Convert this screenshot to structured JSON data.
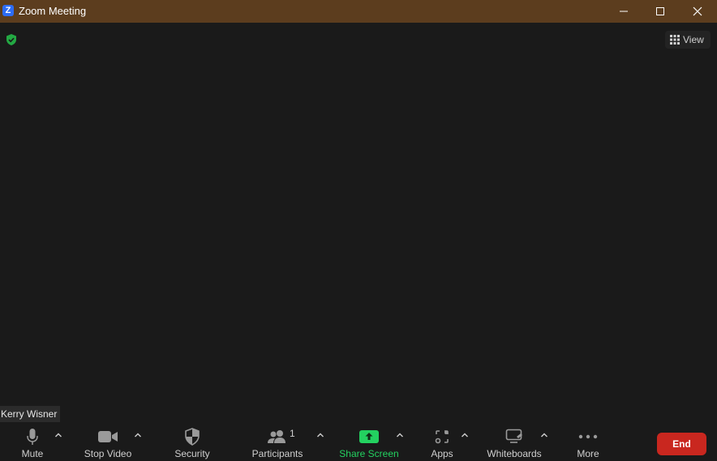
{
  "window": {
    "title": "Zoom Meeting",
    "logo_letter": "Z"
  },
  "colors": {
    "titlebar": "#5c3d1e",
    "background": "#1a1a1a",
    "security_green": "#23a943",
    "share_green": "#23d160",
    "end_red": "#c9271f",
    "logo_blue": "#2d6cf6"
  },
  "top": {
    "view_label": "View"
  },
  "participant_name": "Kerry Wisner",
  "toolbar": {
    "mute_label": "Mute",
    "stop_video_label": "Stop Video",
    "security_label": "Security",
    "participants_label": "Participants",
    "participants_count": "1",
    "share_screen_label": "Share Screen",
    "apps_label": "Apps",
    "whiteboards_label": "Whiteboards",
    "more_label": "More",
    "end_label": "End"
  },
  "icons": {
    "app": "zoom-logo-icon",
    "minimize": "minimize-icon",
    "maximize": "maximize-icon",
    "close": "close-icon",
    "shield": "shield-check-icon",
    "grid": "grid-icon",
    "mic": "microphone-icon",
    "video": "video-camera-icon",
    "security": "security-shield-icon",
    "participants": "people-icon",
    "share": "share-screen-icon",
    "apps": "apps-icon",
    "whiteboard": "whiteboard-icon",
    "more": "more-dots-icon",
    "caret": "chevron-up-icon"
  }
}
